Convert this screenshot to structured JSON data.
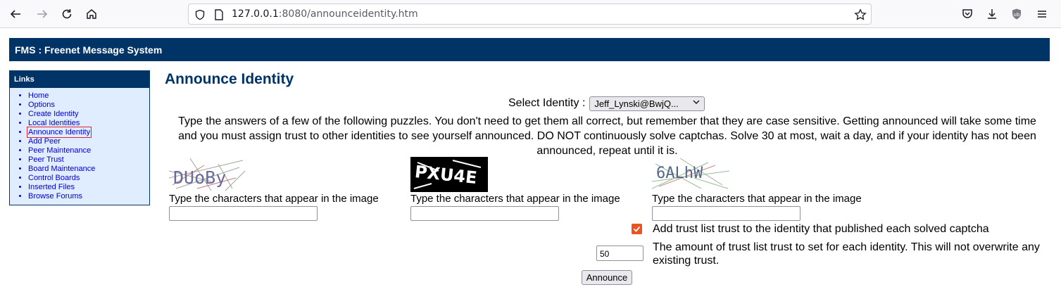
{
  "browser": {
    "url_host": "127.0.0.1",
    "url_rest": ":8080/announceidentity.htm",
    "icons": [
      "back-icon",
      "forward-icon",
      "reload-icon",
      "home-icon",
      "shield-icon",
      "page-info-icon",
      "star-icon",
      "pocket-icon",
      "download-icon",
      "ublock-icon",
      "menu-icon"
    ]
  },
  "header": {
    "title": "FMS : Freenet Message System"
  },
  "links": {
    "title": "Links",
    "items": [
      {
        "label": "Home"
      },
      {
        "label": "Options"
      },
      {
        "label": "Create Identity"
      },
      {
        "label": "Local Identities"
      },
      {
        "label": "Announce Identity"
      },
      {
        "label": "Add Peer"
      },
      {
        "label": "Peer Maintenance"
      },
      {
        "label": "Peer Trust"
      },
      {
        "label": "Board Maintenance"
      },
      {
        "label": "Control Boards"
      },
      {
        "label": "Inserted Files"
      },
      {
        "label": "Browse Forums"
      }
    ]
  },
  "main": {
    "title": "Announce Identity",
    "select_label": "Select Identity :",
    "select_value": "Jeff_Lynski@BwjQ...",
    "instructions": "Type the answers of a few of the following puzzles. You don't need to get them all correct, but remember that they are case sensitive. Getting announced will take some time and you must assign trust to other identities to see yourself announced. DO NOT continuously solve captchas. Solve 30 at most, wait a day, and if your identity has not been announced, repeat until it is.",
    "captchas": [
      {
        "label": "Type the characters that appear in the image",
        "value": "",
        "image_text": "DUoBy"
      },
      {
        "label": "Type the characters that appear in the image",
        "value": "",
        "image_text": "PXU4E"
      },
      {
        "label": "Type the characters that appear in the image",
        "value": "",
        "image_text": "6ALhW"
      }
    ],
    "checkbox_label": "Add trust list trust to the identity that published each solved captcha",
    "checkbox_checked": true,
    "trust_value": "50",
    "trust_text": "The amount of trust list trust to set for each identity. This will not overwrite any existing trust.",
    "announce_label": "Announce"
  },
  "colors": {
    "header_bg": "#003366",
    "links_bg": "#e0ecff",
    "checkbox": "#e95420"
  }
}
